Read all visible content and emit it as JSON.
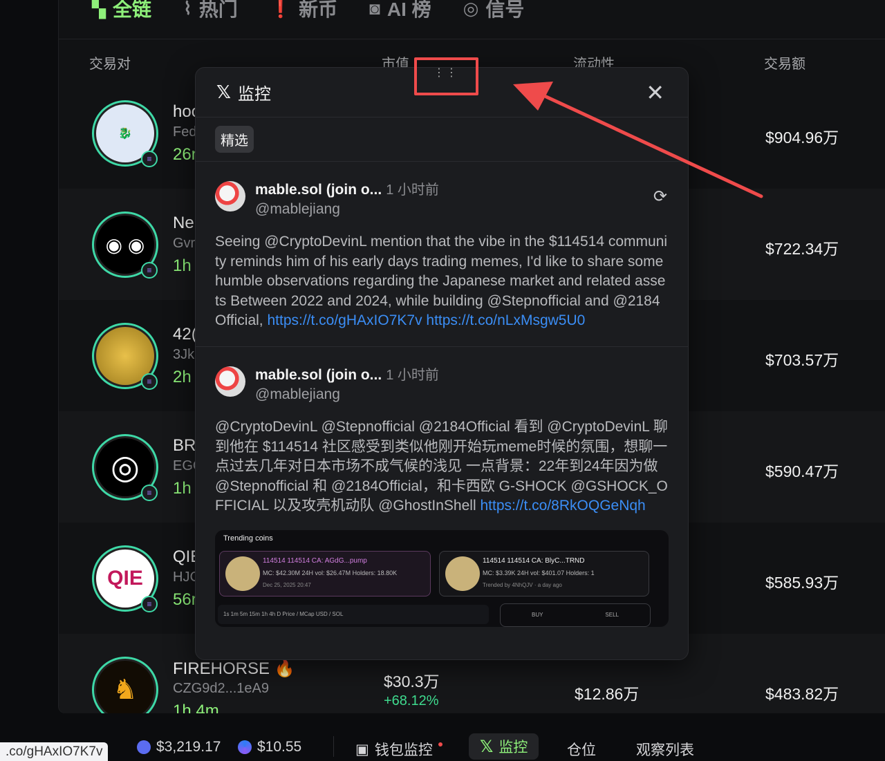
{
  "nav": {
    "items": [
      {
        "label": "全链",
        "icon": "chain-icon",
        "active": true
      },
      {
        "label": "热门",
        "icon": "trending-icon",
        "active": false
      },
      {
        "label": "新币",
        "icon": "pin-icon",
        "active": false
      },
      {
        "label": "AI 榜",
        "icon": "robot-icon",
        "active": false
      },
      {
        "label": "信号",
        "icon": "signal-icon",
        "active": false
      }
    ]
  },
  "table": {
    "headers": {
      "pair": "交易对",
      "mcap": "市值",
      "liquidity": "流动性",
      "volume": "交易额"
    },
    "rows": [
      {
        "name": "hoo",
        "addr": "Fed",
        "age": "26n",
        "volume": "$904.96万"
      },
      {
        "name": "Ne",
        "addr": "Gvr",
        "age": "1h",
        "volume": "$722.34万"
      },
      {
        "name": "42(",
        "addr": "3Jk",
        "age": "2h",
        "volume": "$703.57万"
      },
      {
        "name": "BR",
        "addr": "EGO",
        "age": "1h",
        "volume": "$590.47万"
      },
      {
        "name": "QIE",
        "addr": "HJC",
        "age": "56r",
        "volume": "$585.93万"
      },
      {
        "name": "FIREHORSE",
        "addr": "CZG9d2...1eA9",
        "age": "1h 4m",
        "mcap": "$30.3万",
        "mcap_change": "+68.12%",
        "liquidity": "$12.86万",
        "volume": "$483.82万"
      }
    ],
    "avatar_texts": {
      "qie": "QIE"
    }
  },
  "popup": {
    "title": "监控",
    "x_logo": "𝕏",
    "filter_chip": "精选",
    "close_label": "✕",
    "drag_handle": "⋮⋮",
    "tweets": [
      {
        "name": "mable.sol (join o...",
        "time": "1 小时前",
        "handle": "@mablejiang",
        "text": "Seeing @CryptoDevinL mention that the vibe in the $114514 community reminds him of his early days trading memes, I'd like to share some humble observations regarding the Japanese market and related assets Between 2022 and 2024, while building @Stepnofficial and @2184Official, ",
        "links": "https://t.co/gHAxIO7K7v https://t.co/nLxMsgw5U0"
      },
      {
        "name": "mable.sol (join o...",
        "time": "1 小时前",
        "handle": "@mablejiang",
        "text": "@CryptoDevinL @Stepnofficial @2184Official 看到 @CryptoDevinL 聊到他在 $114514 社区感受到类似他刚开始玩meme时候的氛围，想聊一点过去几年对日本市场不成气候的浅见 一点背景：22年到24年因为做 @Stepnofficial 和 @2184Official，和卡西欧 G-SHOCK @GSHOCK_OFFICIAL 以及攻壳机动队 @GhostInShell ",
        "links": "https://t.co/8RkOQGeNqh"
      }
    ],
    "media": {
      "title": "Trending coins",
      "card1": {
        "title": "114514  114514  CA: AGdG...pump",
        "metrics": "MC: $42.30M  24H vol: $26.47M  Holders: 18.80K",
        "date": "Dec 25, 2025 20:47"
      },
      "card2": {
        "title": "114514  114514  CA: BlyC...TRND",
        "metrics": "MC: $3.39K  24H vol: $401.07  Holders: 1",
        "date": "Trended by 4NhQJV · a day ago"
      },
      "toolbar": "1s  1m  5m  15m  1h  4h  D   Price / MCap   USD / SOL",
      "buy": "BUY",
      "sell": "SELL"
    }
  },
  "bottombar": {
    "url_tip": ".co/gHAxIO7K7v",
    "eth_price": "$3,219.17",
    "sol_price": "$10.55",
    "wallet_monitor": "钱包监控",
    "x_monitor": "监控",
    "positions": "仓位",
    "watchlist": "观察列表"
  },
  "colors": {
    "accent": "#8ef07a",
    "link": "#3b8ef6",
    "highlight": "#ef4b4b"
  }
}
